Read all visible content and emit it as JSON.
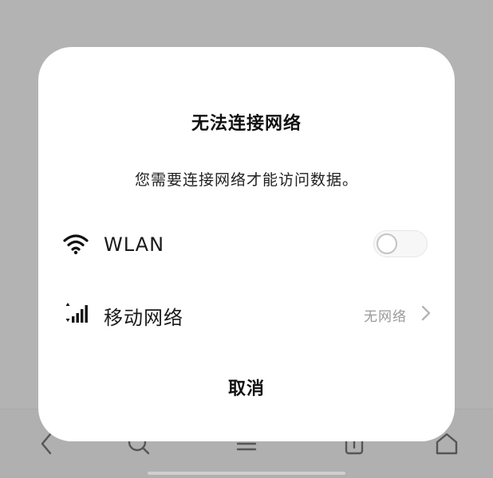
{
  "dialog": {
    "title": "无法连接网络",
    "message": "您需要连接网络才能访问数据。",
    "wlan": {
      "label": "WLAN",
      "icon": "wifi-icon",
      "toggle_on": false
    },
    "mobile": {
      "label": "移动网络",
      "icon": "cellular-signal-icon",
      "status": "无网络"
    },
    "cancel_label": "取消"
  },
  "bottom_bar": {
    "icons": [
      "back-icon",
      "search-icon",
      "menu-icon",
      "tabs-icon",
      "home-icon"
    ]
  },
  "colors": {
    "overlay": "#b3b3b3",
    "dialog_bg": "#ffffff",
    "secondary_text": "#9a9a9a"
  }
}
